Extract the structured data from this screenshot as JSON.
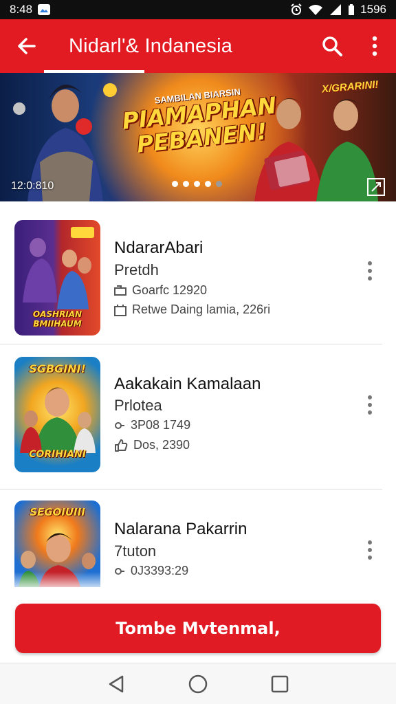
{
  "status_bar": {
    "time": "8:48",
    "battery_text": "1596",
    "colors": {
      "background": "#0f0f0f",
      "text": "#ffffff"
    }
  },
  "app_bar": {
    "title": "Nidarl'& Indanesia",
    "back_icon": "arrow-left-icon",
    "search_icon": "search-icon",
    "more_icon": "more-vert-icon",
    "color": "#e21b23"
  },
  "banner": {
    "kicker": "SAMBILAN BIARSIN",
    "title_line1": "PIAMAPHAN",
    "title_line2": "PEBANEN!",
    "corner_text": "X/GRARINI!",
    "timestamp": "12:0:810",
    "slide_count": 5,
    "active_slide": 1,
    "expand_icon": "expand-icon"
  },
  "list": {
    "items": [
      {
        "title": "NdararAbari",
        "subtitle": "Pretdh",
        "meta1": "Goarfc 12920",
        "meta2": "Retwe Daing lamia, 226ri",
        "meta1_icon": "card-icon",
        "meta2_icon": "calendar-icon",
        "thumb_label": "OASHRIAN\nBMIIHAUM",
        "thumb_badge": "WARN",
        "thumb_colors": [
          "#3a1f7a",
          "#b3272b"
        ]
      },
      {
        "title": "Aakakain Kamalaan",
        "subtitle": "Prlotea",
        "meta1": "3P08 1749",
        "meta2": "Dos, 2390",
        "meta1_icon": "link-icon",
        "meta2_icon": "thumb-icon",
        "thumb_top": "SGBGINI!",
        "thumb_label": "CORIHIANI",
        "thumb_colors": [
          "#1a7fc4",
          "#e8a11a"
        ]
      },
      {
        "title": "Nalarana Pakarrin",
        "subtitle": "7tuton",
        "meta1": "0J3393:29",
        "meta1_icon": "link-icon",
        "thumb_top": "SEGOIUIII",
        "thumb_colors": [
          "#1e6fd1",
          "#d8421f"
        ]
      }
    ]
  },
  "primary_action": {
    "label": "Tombe Mvtenmal,",
    "color": "#e01b24"
  },
  "nav_bar": {
    "back_icon": "nav-back-icon",
    "home_icon": "nav-home-icon",
    "recents_icon": "nav-recents-icon"
  }
}
